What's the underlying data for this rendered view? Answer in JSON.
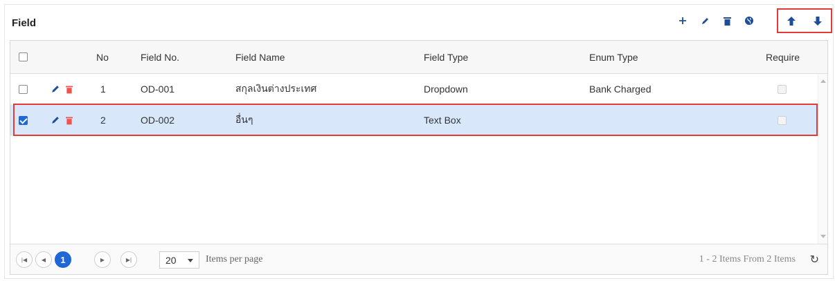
{
  "panel": {
    "title": "Field"
  },
  "toolbar": {
    "buttons": [
      {
        "name": "add",
        "icon": "plus-icon"
      },
      {
        "name": "edit",
        "icon": "pencil-icon"
      },
      {
        "name": "delete",
        "icon": "trash-icon"
      },
      {
        "name": "globe",
        "icon": "globe-icon"
      }
    ],
    "move": [
      {
        "name": "move-up",
        "icon": "arrow-up-icon"
      },
      {
        "name": "move-down",
        "icon": "arrow-down-icon"
      }
    ]
  },
  "grid": {
    "columns": {
      "no": "No",
      "field_no": "Field No.",
      "field_name": "Field Name",
      "field_type": "Field Type",
      "enum_type": "Enum Type",
      "require": "Require"
    },
    "rows": [
      {
        "no": "1",
        "field_no": "OD-001",
        "field_name": "สกุลเงินต่างประเทศ",
        "field_type": "Dropdown",
        "enum_type": "Bank Charged",
        "selected": false
      },
      {
        "no": "2",
        "field_no": "OD-002",
        "field_name": "อื่นๆ",
        "field_type": "Text Box",
        "enum_type": "",
        "selected": true
      }
    ]
  },
  "pager": {
    "current_page": "1",
    "page_size": "20",
    "items_per_page_label": "Items per page",
    "info": "1 - 2 Items From 2 Items"
  },
  "colors": {
    "accent": "#1f66d6",
    "highlight": "#e53935",
    "selected_row": "#d9e7fb"
  }
}
